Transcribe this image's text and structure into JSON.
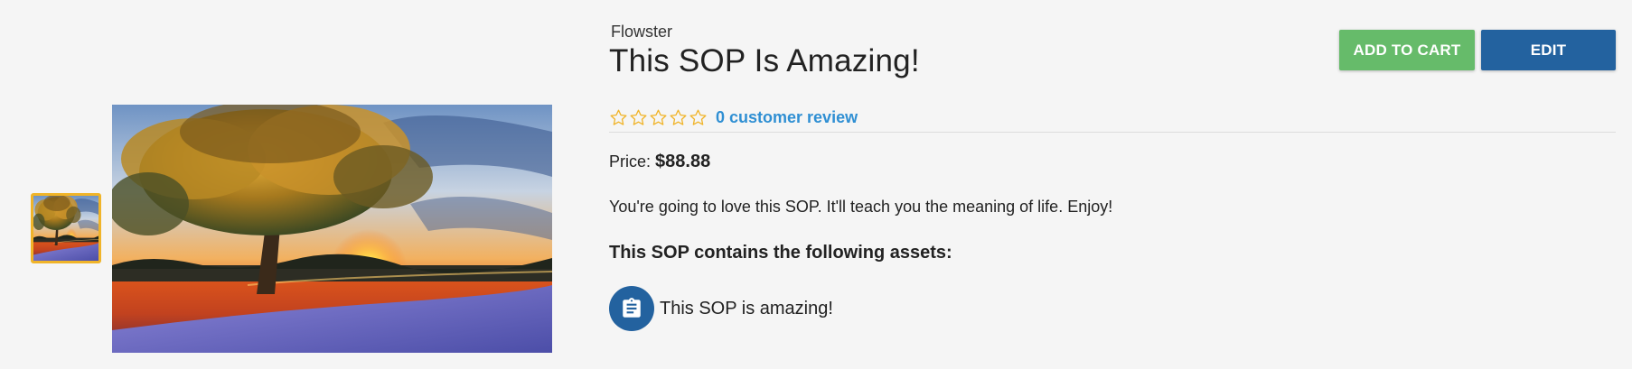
{
  "gallery": {
    "thumbnail_count": 1,
    "selected_index": 0,
    "image_subject": "tree-at-sunset",
    "selected_border_color": "#f0b429"
  },
  "product": {
    "brand": "Flowster",
    "title": "This SOP Is Amazing!",
    "rating": 0,
    "rating_max": 5,
    "review_link_text": "0 customer review",
    "price_label": "Price:",
    "price_value": "$88.88",
    "description": "You're going to love this SOP. It'll teach you the meaning of life. Enjoy!",
    "assets_heading": "This SOP contains the following assets:",
    "assets": [
      {
        "label": "This SOP is amazing!",
        "icon": "clipboard-icon"
      }
    ]
  },
  "actions": {
    "add_to_cart_label": "ADD TO CART",
    "edit_label": "EDIT"
  },
  "colors": {
    "add_to_cart": "#66bb6a",
    "edit": "#23629f",
    "link": "#2f8fd3",
    "star_outline": "#f0b429",
    "asset_icon_bg": "#23629f"
  }
}
